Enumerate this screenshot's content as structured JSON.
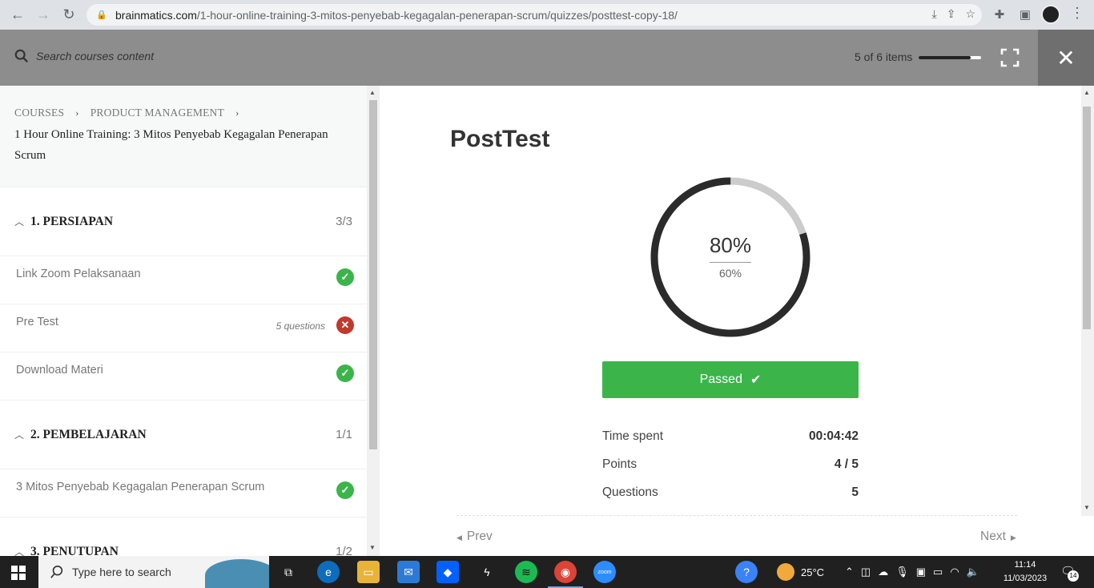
{
  "browser": {
    "url_host": "brainmatics.com",
    "url_path": "/1-hour-online-training-3-mitos-penyebab-kegagalan-penerapan-scrum/quizzes/posttest-copy-18/"
  },
  "topbar": {
    "search_placeholder": "Search courses content",
    "progress_text": "5 of 6 items",
    "progress_fraction": 0.83
  },
  "sidebar": {
    "breadcrumb": [
      "COURSES",
      "PRODUCT MANAGEMENT"
    ],
    "course_title": "1 Hour Online Training: 3 Mitos Penyebab Kegagalan Penerapan Scrum",
    "sections": [
      {
        "title": "1. PERSIAPAN",
        "count": "3/3",
        "items": [
          {
            "label": "Link Zoom Pelaksanaan",
            "meta": "",
            "status": "passed"
          },
          {
            "label": "Pre Test",
            "meta": "5 questions",
            "status": "failed"
          },
          {
            "label": "Download Materi",
            "meta": "",
            "status": "passed"
          }
        ]
      },
      {
        "title": "2. PEMBELAJARAN",
        "count": "1/1",
        "items": [
          {
            "label": "3 Mitos Penyebab Kegagalan Penerapan Scrum",
            "meta": "",
            "status": "passed"
          }
        ]
      },
      {
        "title": "3. PENUTUPAN",
        "count": "1/2",
        "items": []
      }
    ]
  },
  "main": {
    "quiz_title": "PostTest",
    "result_percent": "80%",
    "passing_percent": "60%",
    "result_fraction": 0.8,
    "status_label": "Passed",
    "stats": [
      {
        "label": "Time spent",
        "value": "00:04:42"
      },
      {
        "label": "Points",
        "value": "4 / 5"
      },
      {
        "label": "Questions",
        "value": "5"
      }
    ],
    "prev_label": "Prev",
    "next_label": "Next"
  },
  "taskbar": {
    "search_text": "Type here to search",
    "weather": "25°C",
    "time": "11:14",
    "date": "11/03/2023",
    "notifications": "14"
  },
  "colors": {
    "accent_green": "#3bb54a",
    "fail_red": "#c0392b",
    "topbar_gray": "#8d8d8d"
  }
}
